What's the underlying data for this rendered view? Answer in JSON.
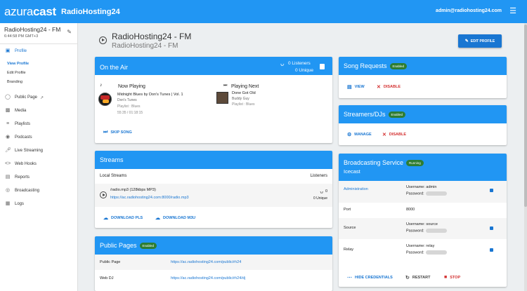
{
  "topbar": {
    "logo_main": "azura",
    "logo_bold": "cast",
    "station_name": "RadioHosting24",
    "user_email": "admin@radiohosting24.com"
  },
  "sidebar": {
    "station_title": "RadioHosting24 - FM",
    "station_time": "6:44:58 PM GMT+3",
    "items": [
      {
        "label": "Profile",
        "icon": "profile-icon"
      },
      {
        "label": "Public Page",
        "icon": "globe-icon"
      },
      {
        "label": "Media",
        "icon": "media-icon"
      },
      {
        "label": "Playlists",
        "icon": "playlist-icon"
      },
      {
        "label": "Podcasts",
        "icon": "podcast-icon"
      },
      {
        "label": "Live Streaming",
        "icon": "mic-icon"
      },
      {
        "label": "Web Hooks",
        "icon": "code-icon"
      },
      {
        "label": "Reports",
        "icon": "report-icon"
      },
      {
        "label": "Broadcasting",
        "icon": "broadcast-icon"
      },
      {
        "label": "Logs",
        "icon": "log-icon"
      }
    ],
    "sub_items": [
      {
        "label": "View Profile"
      },
      {
        "label": "Edit Profile"
      },
      {
        "label": "Branding"
      }
    ]
  },
  "header": {
    "title": "RadioHosting24 - FM",
    "subtitle": "RadioHosting24 - FM",
    "edit_button": "EDIT PROFILE"
  },
  "on_air": {
    "title": "On the Air",
    "listeners": "0 Listeners",
    "unique": "0  Unique",
    "now_playing_label": "Now Playing",
    "now_song": "Midnight Blues by Don's Tunes | Vol. 1",
    "now_artist": "Don's Tunes",
    "now_playlist": "Playlist : Blues",
    "now_time": "55:35 / 01:18:15",
    "next_label": "Playing Next",
    "next_song": "Done Got Old",
    "next_artist": "Buddy Guy",
    "next_playlist": "Playlist : Blues",
    "skip": "SKIP SONG"
  },
  "streams": {
    "title": "Streams",
    "col_local": "Local Streams",
    "col_listeners": "Listeners",
    "stream_name": "/radio.mp3 (128kbps MP3)",
    "stream_url": "https://ac.radiohosting24.com:8000/radio.mp3",
    "stream_count": "0",
    "stream_unique": "0  Unique",
    "download_pls": "DOWNLOAD PLS",
    "download_m3u": "DOWNLOAD M3U"
  },
  "public_pages": {
    "title": "Public Pages",
    "badge": "Enabled",
    "rows": [
      {
        "label": "Public Page",
        "url": "https://ac.radiohosting24.com/public/rh24"
      },
      {
        "label": "Web DJ",
        "url": "https://ac.radiohosting24.com/public/rh24/dj"
      }
    ]
  },
  "song_requests": {
    "title": "Song Requests",
    "badge": "Enabled",
    "view": "VIEW",
    "disable": "DISABLE"
  },
  "streamers": {
    "title": "Streamers/DJs",
    "badge": "Enabled",
    "manage": "MANAGE",
    "disable": "DISABLE"
  },
  "broadcasting": {
    "title": "Broadcasting Service",
    "badge": "Running",
    "subtitle": "Icecast",
    "rows": [
      {
        "label": "Administration",
        "line1": "Username: admin",
        "line2": "Password:"
      },
      {
        "label": "Port",
        "line1": "8000",
        "line2": ""
      },
      {
        "label": "Source",
        "line1": "Username: source",
        "line2": "Password:"
      },
      {
        "label": "Relay",
        "line1": "Username: relay",
        "line2": "Password:"
      }
    ],
    "hide_credentials": "HIDE CREDENTIALS",
    "restart": "RESTART",
    "stop": "STOP"
  },
  "colors": {
    "primary": "#2196f3",
    "dark_primary": "#1976d2",
    "success": "#2e7d32",
    "danger": "#d32f2f"
  }
}
